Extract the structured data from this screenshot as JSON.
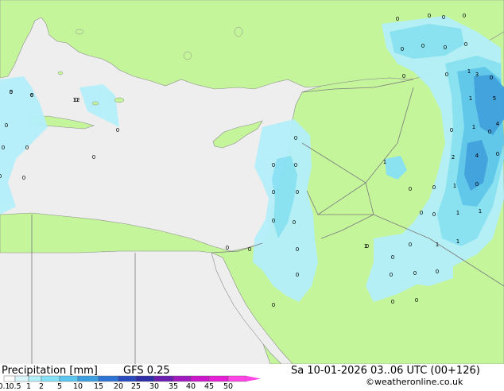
{
  "footer": {
    "title": "Precipitation [mm]",
    "model": "GFS 0.25",
    "valid_time": "Sa 10-01-2026 03..06 UTC (00+126)",
    "credit": "©weatheronline.co.uk"
  },
  "legend": {
    "ticks": [
      "0.1",
      "0.5",
      "1",
      "2",
      "5",
      "10",
      "15",
      "20",
      "25",
      "30",
      "35",
      "40",
      "45",
      "50"
    ],
    "colors": [
      "#ffffff",
      "#d9f7fb",
      "#b4effa",
      "#87e1f5",
      "#5cc6ee",
      "#3d9fe0",
      "#2e74d2",
      "#2a4bc0",
      "#2e2fa6",
      "#6a1fb0",
      "#a01ac0",
      "#cc18cc",
      "#e61fd6",
      "#ff44e8"
    ]
  },
  "map_colors": {
    "land": "#c4f59b",
    "sea": "#eeeeee",
    "border": "#7a7a7a",
    "coast": "#8c8c8c"
  },
  "values": [
    "0",
    "0",
    "0",
    "0",
    "0",
    "0",
    "0",
    "0",
    "0",
    "0",
    "0",
    "0",
    "0",
    "0",
    "0",
    "0",
    "0",
    "0",
    "0",
    "0",
    "0",
    "0",
    "0",
    "0",
    "0",
    "0",
    "0",
    "0",
    "0",
    "0",
    "0",
    "0",
    "0",
    "0",
    "0",
    "0",
    "0",
    "0",
    "0",
    "0",
    "0",
    "0",
    "0",
    "0",
    "0",
    "0",
    "0",
    "0",
    "0",
    "1",
    "1",
    "1",
    "1",
    "1",
    "1",
    "1",
    "1",
    "1",
    "1",
    "2",
    "3",
    "4",
    "4",
    "5",
    "5",
    "6",
    "12"
  ]
}
